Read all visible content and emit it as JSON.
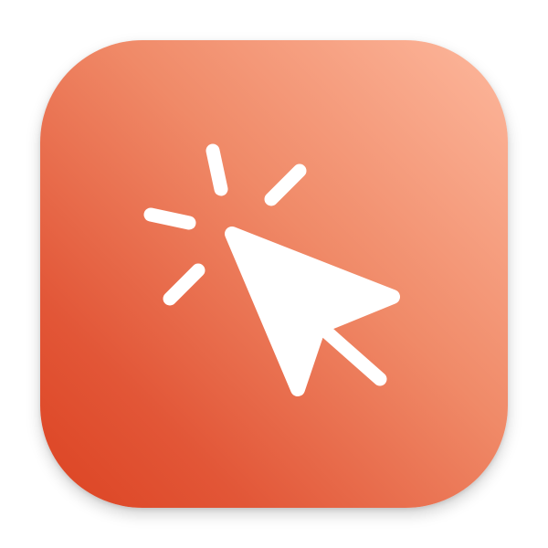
{
  "app_icon": {
    "name": "click-cursor-app-icon",
    "gradient_colors": [
      "#fdb89d",
      "#f08a68",
      "#e25637",
      "#dc4322"
    ],
    "glyph_color": "#ffffff",
    "glyph": "cursor-click-icon"
  }
}
